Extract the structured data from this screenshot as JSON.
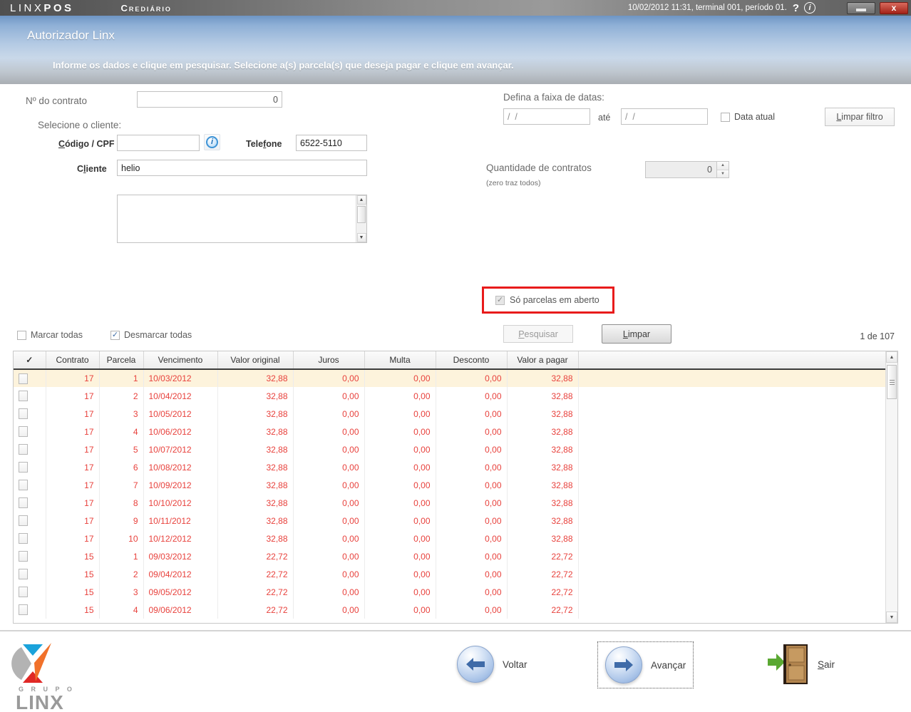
{
  "titlebar": {
    "brand_prefix": "LINX",
    "brand_suffix": "POS",
    "module": "Crediário",
    "status": "10/02/2012 11:31, terminal 001, período 01.",
    "help_glyph": "?",
    "info_glyph": "i",
    "minimize_title": "Minimizar",
    "close_glyph": "x"
  },
  "banner": {
    "title": "Autorizador Linx",
    "subtitle": "Informe os dados e clique em pesquisar. Selecione a(s) parcela(s) que deseja pagar e clique em avançar."
  },
  "form": {
    "contract_label": "Nº do contrato",
    "contract_value": "0",
    "select_client_label": "Selecione o cliente:",
    "codigo_label_pre": "C",
    "codigo_label_accel": "ó",
    "codigo_label_post": "digo / CPF",
    "codigo_label_full": "Código / CPF",
    "codigo_value": "",
    "codigo_placeholder": "",
    "info_icon": "info-icon",
    "telefone_label": "Telefone",
    "telefone_value": "6522-5110",
    "cliente_label": "Cliente",
    "cliente_value": "helio",
    "client_list_items": []
  },
  "filters": {
    "date_range_label": "Defina a faixa de datas:",
    "date_from": "/  /",
    "ate_label": "até",
    "date_to": "/  /",
    "data_atual_label": "Data atual",
    "data_atual_checked": false,
    "limpar_filtro_label": "Limpar filtro",
    "qtd_label": "Quantidade de contratos",
    "qtd_sub_label": "(zero traz todos)",
    "qtd_value": "0",
    "so_parcelas_label": "Só parcelas em aberto",
    "so_parcelas_checked": true,
    "so_parcelas_highlight_color": "#e81b1b",
    "pesquisar_label": "Pesquisar",
    "limpar_label": "Limpar"
  },
  "tablesec": {
    "marcar_todas_label": "Marcar todas",
    "marcar_todas_checked": false,
    "desmarcar_todas_label": "Desmarcar todas",
    "desmarcar_todas_checked": true,
    "record_counter": "1 de 107",
    "columns": [
      {
        "key": "check",
        "label": "✓",
        "align": "center"
      },
      {
        "key": "contrato",
        "label": "Contrato",
        "align": "right"
      },
      {
        "key": "parcela",
        "label": "Parcela",
        "align": "right"
      },
      {
        "key": "vencimento",
        "label": "Vencimento",
        "align": "left"
      },
      {
        "key": "valor_original",
        "label": "Valor original",
        "align": "right"
      },
      {
        "key": "juros",
        "label": "Juros",
        "align": "right"
      },
      {
        "key": "multa",
        "label": "Multa",
        "align": "right"
      },
      {
        "key": "desconto",
        "label": "Desconto",
        "align": "right"
      },
      {
        "key": "valor_a_pagar",
        "label": "Valor a pagar",
        "align": "right"
      }
    ],
    "rows": [
      {
        "selected": true,
        "checked": false,
        "contrato": "17",
        "parcela": "1",
        "vencimento": "10/03/2012",
        "valor_original": "32,88",
        "juros": "0,00",
        "multa": "0,00",
        "desconto": "0,00",
        "valor_a_pagar": "32,88"
      },
      {
        "selected": false,
        "checked": false,
        "contrato": "17",
        "parcela": "2",
        "vencimento": "10/04/2012",
        "valor_original": "32,88",
        "juros": "0,00",
        "multa": "0,00",
        "desconto": "0,00",
        "valor_a_pagar": "32,88"
      },
      {
        "selected": false,
        "checked": false,
        "contrato": "17",
        "parcela": "3",
        "vencimento": "10/05/2012",
        "valor_original": "32,88",
        "juros": "0,00",
        "multa": "0,00",
        "desconto": "0,00",
        "valor_a_pagar": "32,88"
      },
      {
        "selected": false,
        "checked": false,
        "contrato": "17",
        "parcela": "4",
        "vencimento": "10/06/2012",
        "valor_original": "32,88",
        "juros": "0,00",
        "multa": "0,00",
        "desconto": "0,00",
        "valor_a_pagar": "32,88"
      },
      {
        "selected": false,
        "checked": false,
        "contrato": "17",
        "parcela": "5",
        "vencimento": "10/07/2012",
        "valor_original": "32,88",
        "juros": "0,00",
        "multa": "0,00",
        "desconto": "0,00",
        "valor_a_pagar": "32,88"
      },
      {
        "selected": false,
        "checked": false,
        "contrato": "17",
        "parcela": "6",
        "vencimento": "10/08/2012",
        "valor_original": "32,88",
        "juros": "0,00",
        "multa": "0,00",
        "desconto": "0,00",
        "valor_a_pagar": "32,88"
      },
      {
        "selected": false,
        "checked": false,
        "contrato": "17",
        "parcela": "7",
        "vencimento": "10/09/2012",
        "valor_original": "32,88",
        "juros": "0,00",
        "multa": "0,00",
        "desconto": "0,00",
        "valor_a_pagar": "32,88"
      },
      {
        "selected": false,
        "checked": false,
        "contrato": "17",
        "parcela": "8",
        "vencimento": "10/10/2012",
        "valor_original": "32,88",
        "juros": "0,00",
        "multa": "0,00",
        "desconto": "0,00",
        "valor_a_pagar": "32,88"
      },
      {
        "selected": false,
        "checked": false,
        "contrato": "17",
        "parcela": "9",
        "vencimento": "10/11/2012",
        "valor_original": "32,88",
        "juros": "0,00",
        "multa": "0,00",
        "desconto": "0,00",
        "valor_a_pagar": "32,88"
      },
      {
        "selected": false,
        "checked": false,
        "contrato": "17",
        "parcela": "10",
        "vencimento": "10/12/2012",
        "valor_original": "32,88",
        "juros": "0,00",
        "multa": "0,00",
        "desconto": "0,00",
        "valor_a_pagar": "32,88"
      },
      {
        "selected": false,
        "checked": false,
        "contrato": "15",
        "parcela": "1",
        "vencimento": "09/03/2012",
        "valor_original": "22,72",
        "juros": "0,00",
        "multa": "0,00",
        "desconto": "0,00",
        "valor_a_pagar": "22,72"
      },
      {
        "selected": false,
        "checked": false,
        "contrato": "15",
        "parcela": "2",
        "vencimento": "09/04/2012",
        "valor_original": "22,72",
        "juros": "0,00",
        "multa": "0,00",
        "desconto": "0,00",
        "valor_a_pagar": "22,72"
      },
      {
        "selected": false,
        "checked": false,
        "contrato": "15",
        "parcela": "3",
        "vencimento": "09/05/2012",
        "valor_original": "22,72",
        "juros": "0,00",
        "multa": "0,00",
        "desconto": "0,00",
        "valor_a_pagar": "22,72"
      },
      {
        "selected": false,
        "checked": false,
        "contrato": "15",
        "parcela": "4",
        "vencimento": "09/06/2012",
        "valor_original": "22,72",
        "juros": "0,00",
        "multa": "0,00",
        "desconto": "0,00",
        "valor_a_pagar": "22,72"
      }
    ]
  },
  "footer": {
    "logo_grupo": "G R U P O",
    "logo_linx": "LINX",
    "voltar_label": "Voltar",
    "avancar_label": "Avançar",
    "sair_label": "Sair"
  }
}
